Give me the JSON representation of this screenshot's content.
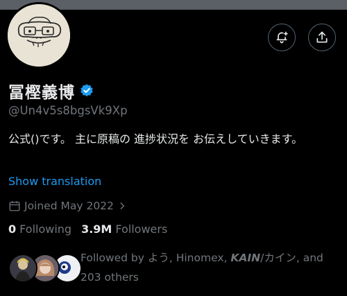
{
  "profile": {
    "display_name": "冨樫義博",
    "handle": "@Un4v5s8bgsVk9Xp",
    "bio": "公式()です。 主に原稿の 進捗状況を お伝えしていきます。",
    "show_translation_label": "Show translation",
    "joined_text": "Joined May 2022",
    "verified_color": "#1d9bf0"
  },
  "stats": {
    "following_count": "0",
    "following_label": "Following",
    "followers_count": "3.9M",
    "followers_label": "Followers"
  },
  "followed_by": {
    "prefix": "Followed by よう, Hinomex, ",
    "kain": "KAIN",
    "rest": "/カイン, and 203 others"
  },
  "icons": [
    "bell-plus-icon",
    "share-icon",
    "verified-badge-icon",
    "calendar-icon",
    "chevron-right-icon"
  ]
}
